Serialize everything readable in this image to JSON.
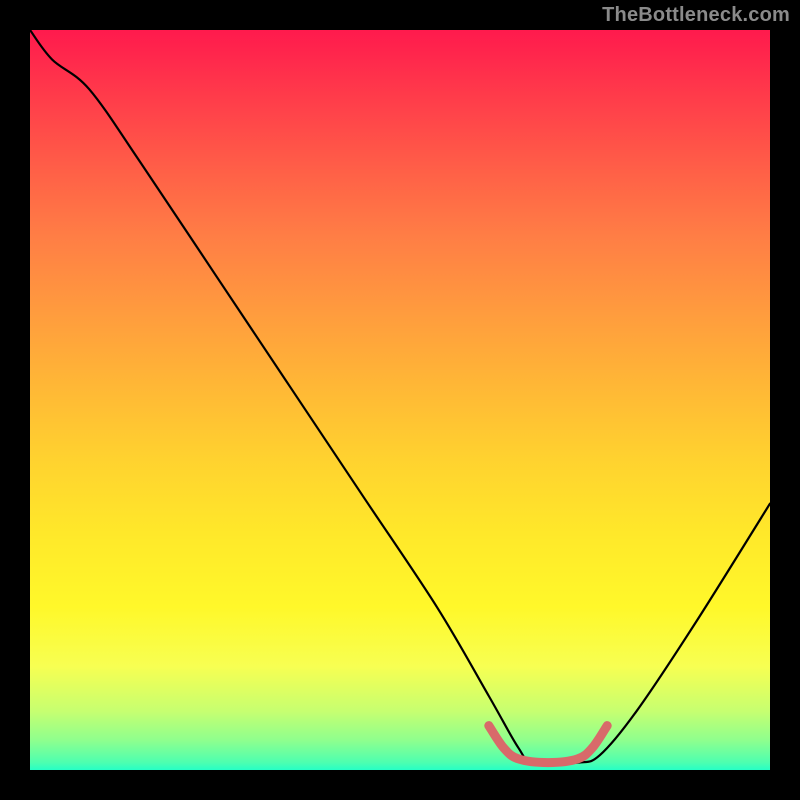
{
  "attribution": "TheBottleneck.com",
  "chart_data": {
    "type": "line",
    "title": "",
    "xlabel": "",
    "ylabel": "",
    "xlim": [
      0,
      100
    ],
    "ylim": [
      0,
      100
    ],
    "series": [
      {
        "name": "black-curve",
        "color": "#000000",
        "points": [
          {
            "x": 0,
            "y": 100
          },
          {
            "x": 3,
            "y": 96
          },
          {
            "x": 8,
            "y": 92
          },
          {
            "x": 15,
            "y": 82
          },
          {
            "x": 25,
            "y": 67
          },
          {
            "x": 35,
            "y": 52
          },
          {
            "x": 45,
            "y": 37
          },
          {
            "x": 55,
            "y": 22
          },
          {
            "x": 62,
            "y": 10
          },
          {
            "x": 66,
            "y": 3
          },
          {
            "x": 68,
            "y": 1
          },
          {
            "x": 74,
            "y": 1
          },
          {
            "x": 77,
            "y": 2
          },
          {
            "x": 82,
            "y": 8
          },
          {
            "x": 90,
            "y": 20
          },
          {
            "x": 100,
            "y": 36
          }
        ]
      },
      {
        "name": "red-valley-segment",
        "color": "#d86a6a",
        "points": [
          {
            "x": 62,
            "y": 6
          },
          {
            "x": 64,
            "y": 3
          },
          {
            "x": 66,
            "y": 1.5
          },
          {
            "x": 70,
            "y": 1
          },
          {
            "x": 74,
            "y": 1.5
          },
          {
            "x": 76,
            "y": 3
          },
          {
            "x": 78,
            "y": 6
          }
        ]
      }
    ],
    "gradient": {
      "direction": "vertical",
      "stops": [
        {
          "pos": 0,
          "color": "#ff1a4d"
        },
        {
          "pos": 50,
          "color": "#ffd22f"
        },
        {
          "pos": 100,
          "color": "#26ffc6"
        }
      ]
    }
  }
}
